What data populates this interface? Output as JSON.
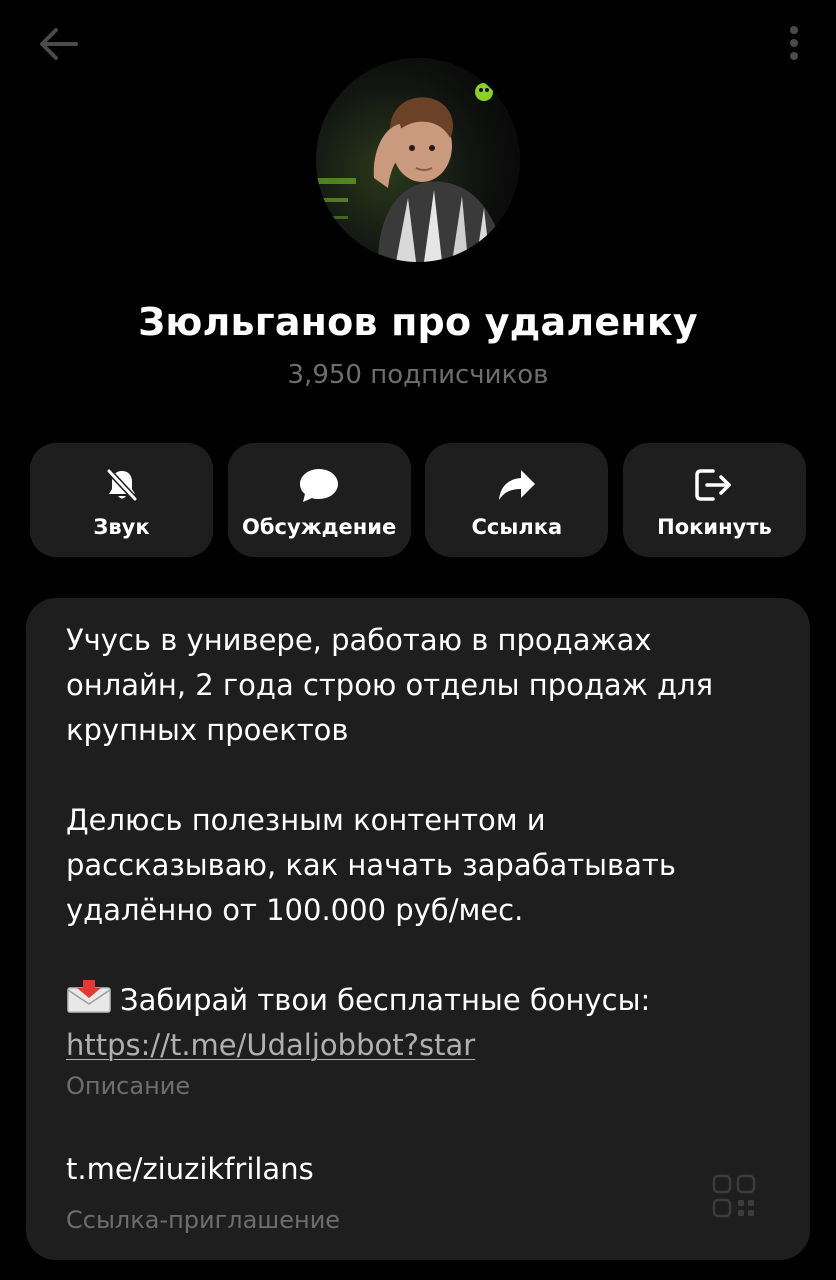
{
  "header": {
    "back_icon": "arrow-left-icon",
    "menu_icon": "more-vertical-icon"
  },
  "channel": {
    "avatar_icon": "channel-avatar-photo",
    "title": "Зюльганов про удаленку",
    "subscribers": "3,950 подписчиков"
  },
  "actions": [
    {
      "label": "Звук",
      "icon": "bell-off-icon"
    },
    {
      "label": "Обсуждение",
      "icon": "chat-bubble-icon"
    },
    {
      "label": "Ссылка",
      "icon": "share-arrow-icon"
    },
    {
      "label": "Покинуть",
      "icon": "leave-icon"
    }
  ],
  "info": {
    "description_lines": [
      "Учусь в универе, работаю в продажах",
      "онлайн, 2 года строю отделы продаж для",
      "крупных проектов",
      "Делюсь полезным контентом и",
      "рассказываю, как начать зарабатывать",
      "удалённо от 100.000 руб/мес.",
      "Забирай твои бесплатные бонусы:"
    ],
    "description_link": "https://t.me/Udaljobbot?star",
    "description_caption": "Описание",
    "invite_link": "t.me/ziuzikfrilans",
    "invite_caption": "Ссылка-приглашение",
    "qr_icon": "qr-code-icon"
  },
  "colors": {
    "background": "#000000",
    "card": "#1e1e1e",
    "text_primary": "#ffffff",
    "text_secondary": "#6d6d6d",
    "link": "#b0b0b0"
  }
}
